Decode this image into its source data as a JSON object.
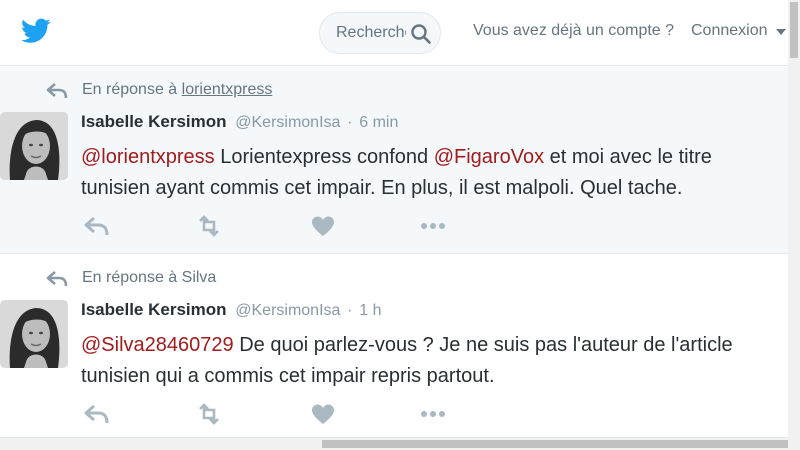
{
  "header": {
    "logo_icon": "twitter-bird-icon",
    "search": {
      "placeholder": "Rechercher",
      "icon": "search-icon"
    },
    "login_prompt": "Vous avez déjà un compte ?",
    "login_link": "Connexion",
    "caret_icon": "chevron-down-icon",
    "accent_color": "#1da1f2"
  },
  "tweets": [
    {
      "context_prefix": "En réponse à",
      "context_target": "lorientxpress",
      "fullname": "Isabelle Kersimon",
      "username": "@KersimonIsa",
      "separator": "·",
      "time": "6 min",
      "mention_1": "@lorientxpress",
      "text_a": " Lorientexpress confond ",
      "mention_2": "@FigaroVox",
      "text_b": " et moi avec le titre tunisien ayant commis cet impair. En plus, il est malpoli. Quel tache."
    },
    {
      "context_prefix": "En réponse à",
      "context_target": "Silva",
      "fullname": "Isabelle Kersimon",
      "username": "@KersimonIsa",
      "separator": "·",
      "time": "1 h",
      "mention_1": "@Silva28460729",
      "text_a": " De quoi parlez-vous ? Je ne suis pas l'auteur de l'article tunisien qui a commis cet impair repris partout."
    }
  ],
  "action_icons": [
    "reply-icon",
    "retweet-icon",
    "heart-icon",
    "more-icon"
  ],
  "colors": {
    "mention": "#a21c1c",
    "muted": "#8899a6",
    "highlight_bg": "#f5f8fa"
  }
}
